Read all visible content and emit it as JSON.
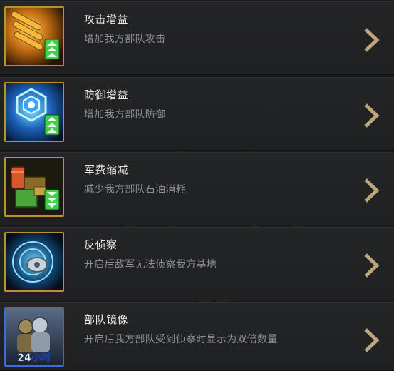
{
  "items": [
    {
      "title": "攻击增益",
      "desc": "增加我方部队攻击",
      "icon": "ammo-boost-icon"
    },
    {
      "title": "防御增益",
      "desc": "增加我方部队防御",
      "icon": "shield-boost-icon"
    },
    {
      "title": "军费缩减",
      "desc": "减少我方部队石油消耗",
      "icon": "supply-crates-icon"
    },
    {
      "title": "反侦察",
      "desc": "开启后敌军无法侦察我方基地",
      "icon": "radar-jammer-icon"
    },
    {
      "title": "部队镜像",
      "desc": "开启后我方部队受到侦察时显示为双倍数量",
      "icon": "soldier-mirror-icon",
      "badge": "24小时"
    }
  ],
  "colors": {
    "accent_gold": "#c8a15a",
    "title_text": "#eae6df",
    "desc_text": "#8f8f8f",
    "boost_green": "#3fd14a"
  }
}
